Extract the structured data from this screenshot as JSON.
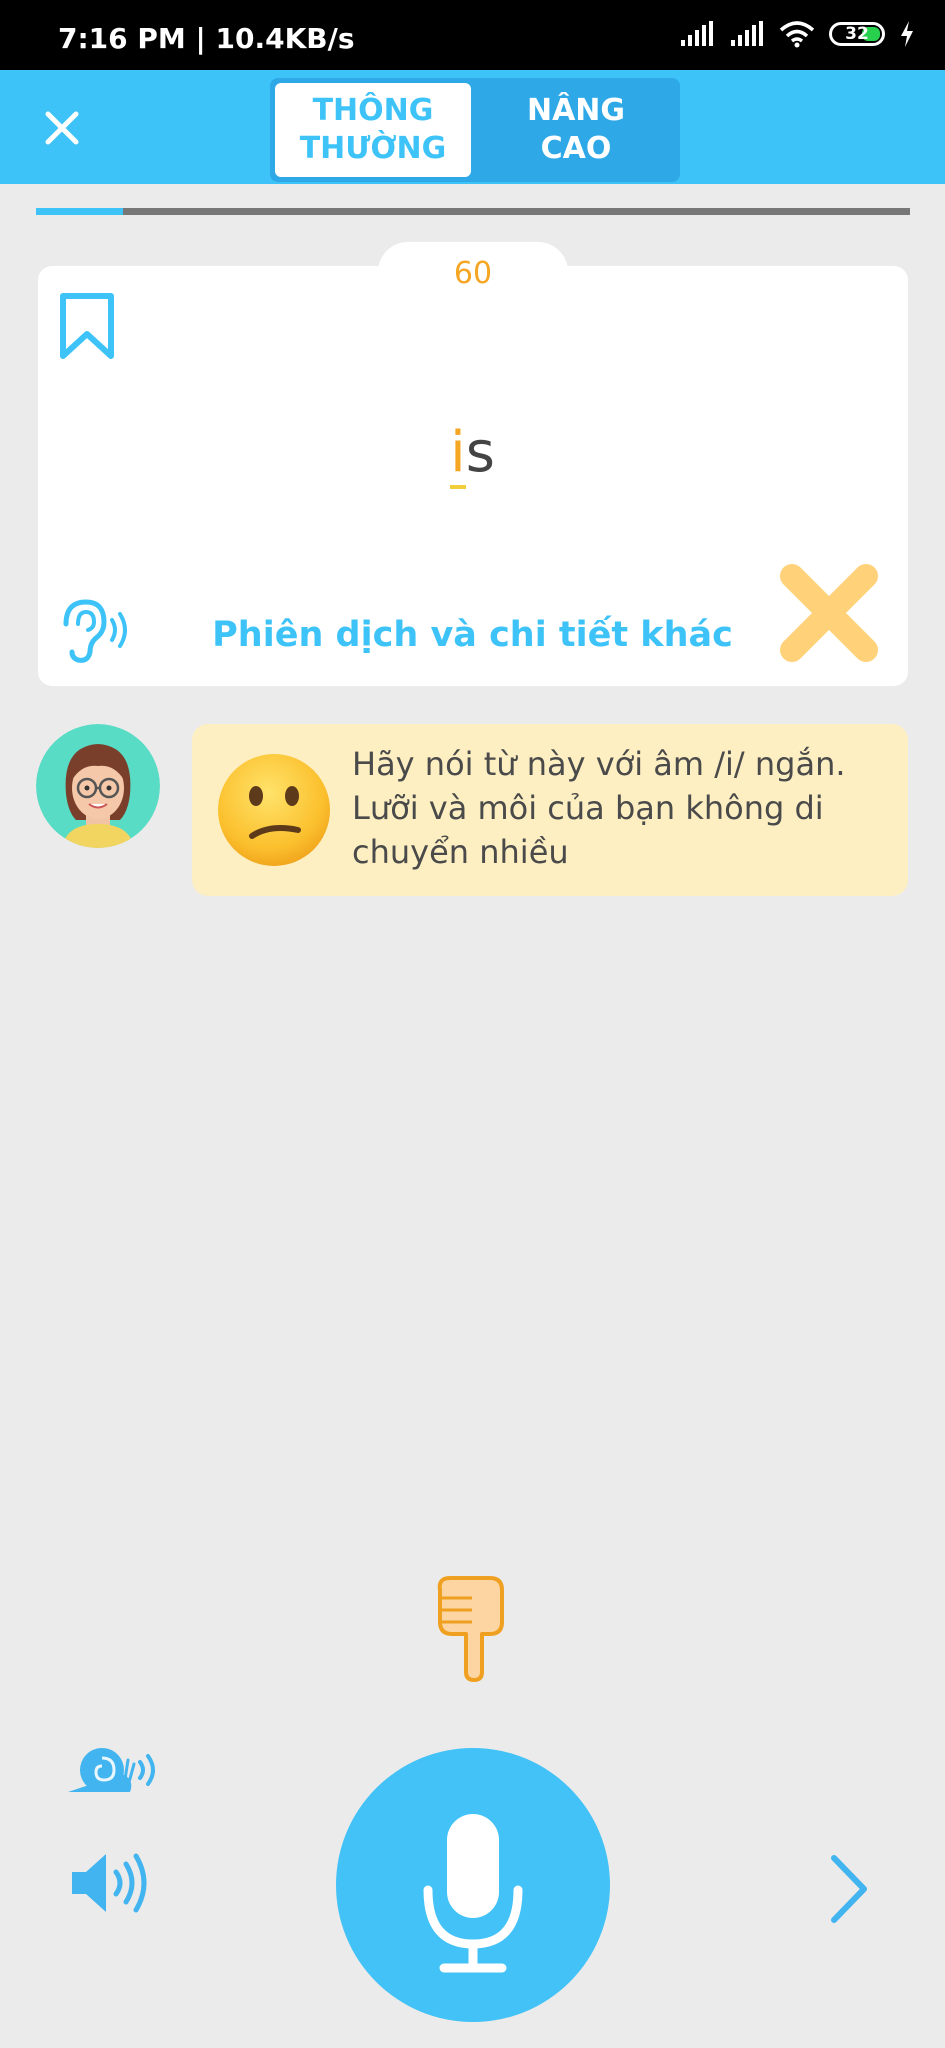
{
  "status_bar": {
    "time_speed": "7:16 PM | 10.4KB/s",
    "battery": "32"
  },
  "header": {
    "tab_normal": "THÔNG\nTHƯỜNG",
    "tab_advanced": "NÂNG\nCAO"
  },
  "progress": {
    "fraction": 0.1
  },
  "card": {
    "score": "60",
    "word_highlight": "i",
    "word_rest": "s",
    "translate_link": "Phiên dịch và chi tiết khác"
  },
  "feedback": {
    "text": "Hãy nói từ này với âm /i/ ngắn. Lưỡi và môi của bạn không di chuyển nhiều"
  },
  "colors": {
    "accent": "#3dc3f7",
    "score": "#f5a623",
    "bubble": "#fdefc2",
    "wrong": "#ffd27a"
  },
  "icons": [
    "close-icon",
    "bookmark-icon",
    "ear-icon",
    "x-mark-icon",
    "confused-face-icon",
    "pointing-down-hand-icon",
    "snail-icon",
    "speaker-icon",
    "microphone-icon",
    "chevron-right-icon"
  ]
}
